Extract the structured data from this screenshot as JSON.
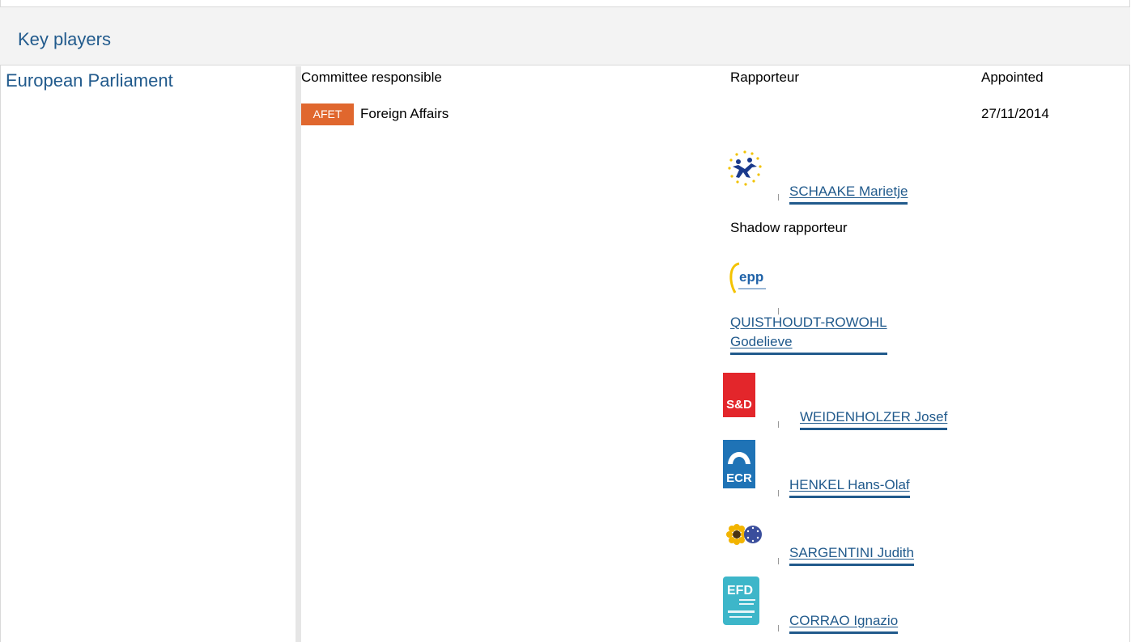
{
  "section": {
    "title": "Key players"
  },
  "institution": {
    "name": "European Parliament"
  },
  "columns": {
    "committee": "Committee responsible",
    "rapporteur": "Rapporteur",
    "appointed": "Appointed"
  },
  "committee": {
    "code": "AFET",
    "name": "Foreign Affairs",
    "appointed": "27/11/2014"
  },
  "rapporteur": {
    "name": "SCHAAKE Marietje",
    "group_icon": "alde-logo"
  },
  "shadow": {
    "label": "Shadow rapporteur",
    "members": [
      {
        "name_line1": "QUISTHOUDT-ROWOHL",
        "name_line2": "Godelieve",
        "group_icon": "epp-logo"
      },
      {
        "name": "WEIDENHOLZER Josef",
        "group_icon": "sd-logo",
        "logo_text": "S&D"
      },
      {
        "name": "HENKEL Hans-Olaf",
        "group_icon": "ecr-logo",
        "logo_text": "ECR"
      },
      {
        "name": "SARGENTINI Judith",
        "group_icon": "greens-efa-logo"
      },
      {
        "name": "CORRAO Ignazio",
        "group_icon": "efdd-logo",
        "logo_text": "EFD"
      }
    ]
  },
  "colors": {
    "link": "#215a8c",
    "badge": "#e0672e",
    "sd": "#e3262b",
    "ecr": "#1f73b6",
    "efd": "#3db6c9"
  }
}
